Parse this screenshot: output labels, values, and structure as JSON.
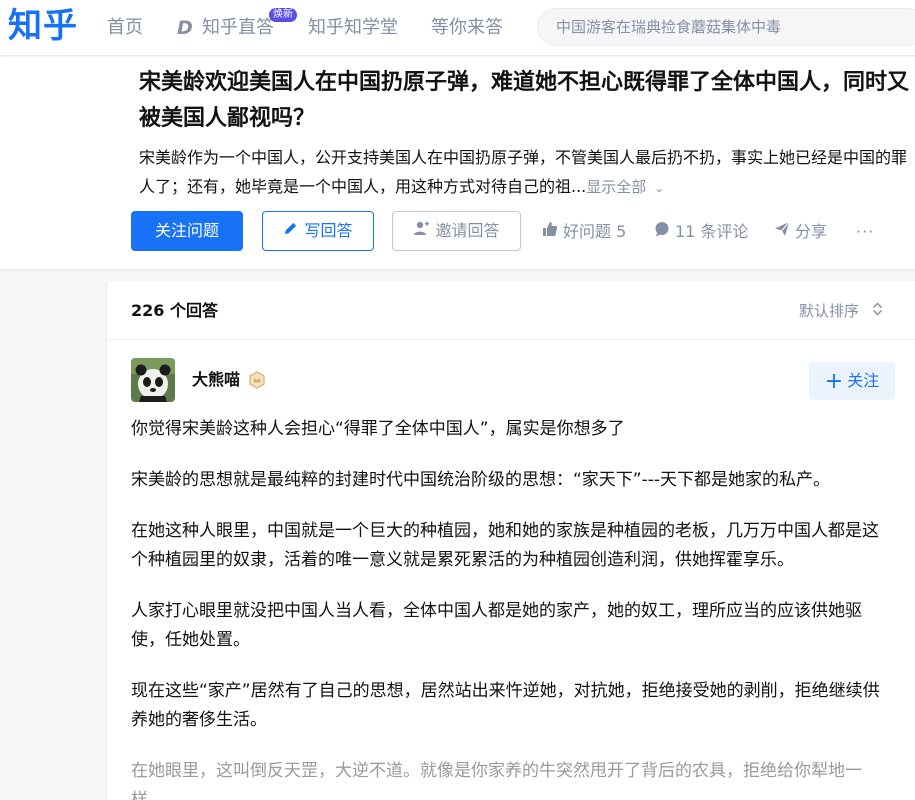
{
  "logo": "知乎",
  "nav": {
    "home": "首页",
    "live": "知乎直答",
    "live_badge": "焕新",
    "learn": "知乎知学堂",
    "wait": "等你来答"
  },
  "search": {
    "placeholder": "中国游客在瑞典捡食蘑菇集体中毒"
  },
  "question": {
    "title": "宋美龄欢迎美国人在中国扔原子弹，难道她不担心既得罪了全体中国人，同时又被美国人鄙视吗？",
    "description": "宋美龄作为一个中国人，公开支持美国人在中国扔原子弹，不管美国人最后扔不扔，事实上她已经是中国的罪人了；还有，她毕竟是一个中国人，用这种方式对待自己的祖...",
    "show_all": "显示全部",
    "buttons": {
      "follow": "关注问题",
      "write": "写回答",
      "invite": "邀请回答"
    },
    "actions": {
      "good": "好问题 5",
      "comments": "11 条评论",
      "share": "分享",
      "more": "···"
    }
  },
  "answers": {
    "count_label": "226 个回答",
    "sort_label": "默认排序",
    "author": {
      "name": "大熊喵",
      "follow_label": "关注"
    },
    "paragraphs": [
      "你觉得宋美龄这种人会担心“得罪了全体中国人”，属实是你想多了",
      "宋美龄的思想就是最纯粹的封建时代中国统治阶级的思想：“家天下”---天下都是她家的私产。",
      "在她这种人眼里，中国就是一个巨大的种植园，她和她的家族是种植园的老板，几万万中国人都是这个种植园里的奴隶，活着的唯一意义就是累死累活的为种植园创造利润，供她挥霍享乐。",
      "人家打心眼里就没把中国人当人看，全体中国人都是她的家产，她的奴工，理所应当的应该供她驱使，任她处置。",
      "现在这些“家产”居然有了自己的思想，居然站出来忤逆她，对抗她，拒绝接受她的剥削，拒绝继续供养她的奢侈生活。",
      "在她眼里，这叫倒反天罡，大逆不道。就像是你家养的牛突然甩开了背后的农具，拒绝给你犁地一样。"
    ]
  },
  "colors": {
    "brand": "#1772f6",
    "muted": "#8590a6",
    "badge": "#5b4fe3",
    "follow_bg": "#ebf3ff"
  }
}
